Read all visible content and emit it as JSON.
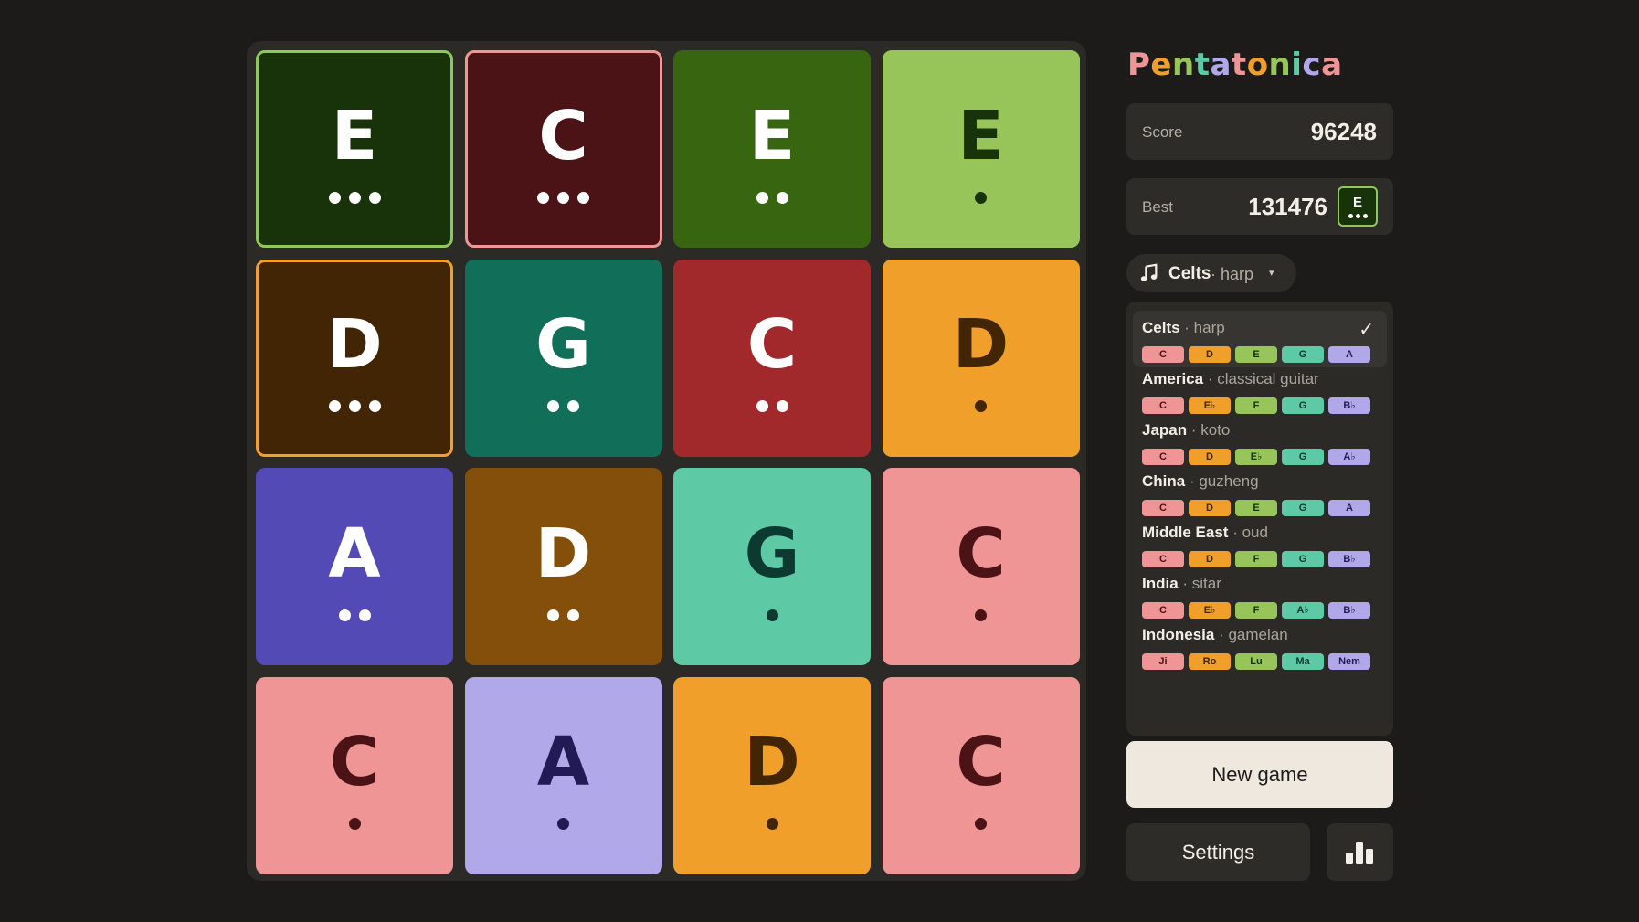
{
  "board": {
    "tiles": [
      {
        "note": "E",
        "dots": 3,
        "bg": "#18330a",
        "fg": "#ffffff",
        "border": "#8fc85a"
      },
      {
        "note": "C",
        "dots": 3,
        "bg": "#4b1316",
        "fg": "#ffffff",
        "border": "#f29595"
      },
      {
        "note": "E",
        "dots": 2,
        "bg": "#376510",
        "fg": "#ffffff",
        "border": ""
      },
      {
        "note": "E",
        "dots": 1,
        "bg": "#98c55a",
        "fg": "#18330a",
        "border": ""
      },
      {
        "note": "D",
        "dots": 3,
        "bg": "#412504",
        "fg": "#ffffff",
        "border": "#f2a02a"
      },
      {
        "note": "G",
        "dots": 2,
        "bg": "#116e58",
        "fg": "#ffffff",
        "border": ""
      },
      {
        "note": "C",
        "dots": 2,
        "bg": "#a1292c",
        "fg": "#ffffff",
        "border": ""
      },
      {
        "note": "D",
        "dots": 1,
        "bg": "#f0a02a",
        "fg": "#412504",
        "border": ""
      },
      {
        "note": "A",
        "dots": 2,
        "bg": "#544ab5",
        "fg": "#ffffff",
        "border": ""
      },
      {
        "note": "D",
        "dots": 2,
        "bg": "#844e0b",
        "fg": "#ffffff",
        "border": ""
      },
      {
        "note": "G",
        "dots": 1,
        "bg": "#5dc9a5",
        "fg": "#0c3a30",
        "border": ""
      },
      {
        "note": "C",
        "dots": 1,
        "bg": "#f09595",
        "fg": "#4b1316",
        "border": ""
      },
      {
        "note": "C",
        "dots": 1,
        "bg": "#f09595",
        "fg": "#4b1316",
        "border": ""
      },
      {
        "note": "A",
        "dots": 1,
        "bg": "#b1a8ea",
        "fg": "#221a55",
        "border": ""
      },
      {
        "note": "D",
        "dots": 1,
        "bg": "#f0a02a",
        "fg": "#412504",
        "border": ""
      },
      {
        "note": "C",
        "dots": 1,
        "bg": "#f09595",
        "fg": "#4b1316",
        "border": ""
      }
    ]
  },
  "sidebar": {
    "brand": {
      "letters": [
        "P",
        "e",
        "n",
        "t",
        "a",
        "t",
        "o",
        "n",
        "i",
        "c",
        "a"
      ],
      "colors": [
        "#f09595",
        "#f0a02a",
        "#98c55a",
        "#5dc9a5",
        "#b1a8ea",
        "#f09595",
        "#f0a02a",
        "#98c55a",
        "#5dc9a5",
        "#b1a8ea",
        "#f09595"
      ]
    },
    "score": {
      "label": "Score",
      "value": "96248"
    },
    "best": {
      "label": "Best",
      "value": "131476",
      "tile_note": "E",
      "tile_dots": 3
    },
    "picker": {
      "name": "Celts",
      "instrument": "· harp",
      "caret": "▾",
      "icon": "music-note-icon"
    },
    "scales": [
      {
        "name": "Celts",
        "instrument": " · harp",
        "selected": true,
        "notes": [
          "C",
          "D",
          "E",
          "G",
          "A"
        ]
      },
      {
        "name": "America",
        "instrument": " · classical guitar",
        "selected": false,
        "notes": [
          "C",
          "E♭",
          "F",
          "G",
          "B♭"
        ]
      },
      {
        "name": "Japan",
        "instrument": " · koto",
        "selected": false,
        "notes": [
          "C",
          "D",
          "E♭",
          "G",
          "A♭"
        ]
      },
      {
        "name": "China",
        "instrument": " · guzheng",
        "selected": false,
        "notes": [
          "C",
          "D",
          "E",
          "G",
          "A"
        ]
      },
      {
        "name": "Middle East",
        "instrument": " · oud",
        "selected": false,
        "notes": [
          "C",
          "D",
          "F",
          "G",
          "B♭"
        ]
      },
      {
        "name": "India",
        "instrument": " · sitar",
        "selected": false,
        "notes": [
          "C",
          "E♭",
          "F",
          "A♭",
          "B♭"
        ]
      },
      {
        "name": "Indonesia",
        "instrument": " · gamelan",
        "selected": false,
        "notes": [
          "Ji",
          "Ro",
          "Lu",
          "Ma",
          "Nem"
        ]
      }
    ],
    "chip_colors": [
      {
        "bg": "#f09595",
        "fg": "#4b1316"
      },
      {
        "bg": "#f0a02a",
        "fg": "#412504"
      },
      {
        "bg": "#98c55a",
        "fg": "#18330a"
      },
      {
        "bg": "#5dc9a5",
        "fg": "#0c3a30"
      },
      {
        "bg": "#b1a8ea",
        "fg": "#221a55"
      }
    ],
    "check_mark": "✓",
    "new_game_label": "New game",
    "settings_label": "Settings",
    "stats_icon": "bar-chart-icon"
  }
}
